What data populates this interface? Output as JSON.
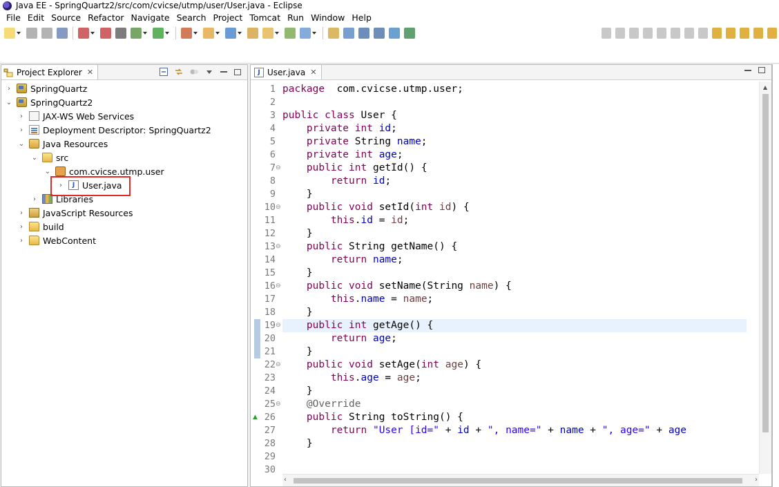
{
  "window": {
    "title": "Java EE - SpringQuartz2/src/com/cvicse/utmp/user/User.java - Eclipse"
  },
  "menu": [
    "File",
    "Edit",
    "Source",
    "Refactor",
    "Navigate",
    "Search",
    "Project",
    "Tomcat",
    "Run",
    "Window",
    "Help"
  ],
  "toolbar_icons": [
    "new-icon",
    "save-icon",
    "save-all-icon",
    "print-icon",
    "debug-icon",
    "run-icon",
    "external-tools-icon",
    "open-type-icon",
    "search-icon",
    "perspective-icon"
  ],
  "explorer": {
    "tab_label": "Project Explorer",
    "close_glyph": "✕",
    "tree": [
      {
        "label": "SpringQuartz",
        "twisty": "›",
        "icon": "project-icon"
      },
      {
        "label": "SpringQuartz2",
        "twisty": "⌄",
        "icon": "project-icon"
      },
      {
        "label": "JAX-WS Web Services",
        "twisty": "›",
        "icon": "web-services-icon"
      },
      {
        "label": "Deployment Descriptor: SpringQuartz2",
        "twisty": "›",
        "icon": "deployment-descriptor-icon"
      },
      {
        "label": "Java Resources",
        "twisty": "⌄",
        "icon": "java-resources-icon"
      },
      {
        "label": "src",
        "twisty": "⌄",
        "icon": "source-folder-icon"
      },
      {
        "label": "com.cvicse.utmp.user",
        "twisty": "⌄",
        "icon": "package-icon"
      },
      {
        "label": "User.java",
        "twisty": "›",
        "icon": "java-file-icon"
      },
      {
        "label": "Libraries",
        "twisty": "›",
        "icon": "libraries-icon"
      },
      {
        "label": "JavaScript Resources",
        "twisty": "›",
        "icon": "javascript-resources-icon"
      },
      {
        "label": "build",
        "twisty": "›",
        "icon": "folder-icon"
      },
      {
        "label": "WebContent",
        "twisty": "›",
        "icon": "folder-icon"
      }
    ]
  },
  "editor": {
    "tab_label": "User.java",
    "close_glyph": "✕",
    "current_line": 19,
    "lines": [
      {
        "n": "1",
        "t": [
          [
            "kw",
            "package"
          ],
          [
            "",
            "  com.cvicse.utmp.user;"
          ]
        ]
      },
      {
        "n": "2",
        "t": []
      },
      {
        "n": "3",
        "t": [
          [
            "kw",
            "public"
          ],
          [
            "",
            " "
          ],
          [
            "kw",
            "class"
          ],
          [
            "",
            " User {"
          ]
        ]
      },
      {
        "n": "4",
        "t": [
          [
            "",
            "    "
          ],
          [
            "kw",
            "private"
          ],
          [
            "",
            " "
          ],
          [
            "kw",
            "int"
          ],
          [
            "",
            " "
          ],
          [
            "fld",
            "id"
          ],
          [
            "",
            ";"
          ]
        ]
      },
      {
        "n": "5",
        "t": [
          [
            "",
            "    "
          ],
          [
            "kw",
            "private"
          ],
          [
            "",
            " String "
          ],
          [
            "fld",
            "name"
          ],
          [
            "",
            ";"
          ]
        ]
      },
      {
        "n": "6",
        "t": [
          [
            "",
            "    "
          ],
          [
            "kw",
            "private"
          ],
          [
            "",
            " "
          ],
          [
            "kw",
            "int"
          ],
          [
            "",
            " "
          ],
          [
            "fld",
            "age"
          ],
          [
            "",
            ";"
          ]
        ]
      },
      {
        "n": "7",
        "t": [
          [
            "",
            "    "
          ],
          [
            "kw",
            "public"
          ],
          [
            "",
            " "
          ],
          [
            "kw",
            "int"
          ],
          [
            "",
            " getId() {"
          ]
        ]
      },
      {
        "n": "8",
        "t": [
          [
            "",
            "        "
          ],
          [
            "kw",
            "return"
          ],
          [
            "",
            " "
          ],
          [
            "fld",
            "id"
          ],
          [
            "",
            ";"
          ]
        ]
      },
      {
        "n": "9",
        "t": [
          [
            "",
            "    }"
          ]
        ]
      },
      {
        "n": "10",
        "t": [
          [
            "",
            "    "
          ],
          [
            "kw",
            "public"
          ],
          [
            "",
            " "
          ],
          [
            "kw",
            "void"
          ],
          [
            "",
            " setId("
          ],
          [
            "kw",
            "int"
          ],
          [
            "",
            " "
          ],
          [
            "prm",
            "id"
          ],
          [
            "",
            ") {"
          ]
        ]
      },
      {
        "n": "11",
        "t": [
          [
            "",
            "        "
          ],
          [
            "kw",
            "this"
          ],
          [
            "",
            "."
          ],
          [
            "fld",
            "id"
          ],
          [
            "",
            " = "
          ],
          [
            "prm",
            "id"
          ],
          [
            "",
            ";"
          ]
        ]
      },
      {
        "n": "12",
        "t": [
          [
            "",
            "    }"
          ]
        ]
      },
      {
        "n": "13",
        "t": [
          [
            "",
            "    "
          ],
          [
            "kw",
            "public"
          ],
          [
            "",
            " String getName() {"
          ]
        ]
      },
      {
        "n": "14",
        "t": [
          [
            "",
            "        "
          ],
          [
            "kw",
            "return"
          ],
          [
            "",
            " "
          ],
          [
            "fld",
            "name"
          ],
          [
            "",
            ";"
          ]
        ]
      },
      {
        "n": "15",
        "t": [
          [
            "",
            "    }"
          ]
        ]
      },
      {
        "n": "16",
        "t": [
          [
            "",
            "    "
          ],
          [
            "kw",
            "public"
          ],
          [
            "",
            " "
          ],
          [
            "kw",
            "void"
          ],
          [
            "",
            " setName(String "
          ],
          [
            "prm",
            "name"
          ],
          [
            "",
            ") {"
          ]
        ]
      },
      {
        "n": "17",
        "t": [
          [
            "",
            "        "
          ],
          [
            "kw",
            "this"
          ],
          [
            "",
            "."
          ],
          [
            "fld",
            "name"
          ],
          [
            "",
            " = "
          ],
          [
            "prm",
            "name"
          ],
          [
            "",
            ";"
          ]
        ]
      },
      {
        "n": "18",
        "t": [
          [
            "",
            "    }"
          ]
        ]
      },
      {
        "n": "19",
        "t": [
          [
            "",
            "    "
          ],
          [
            "kw",
            "public"
          ],
          [
            "",
            " "
          ],
          [
            "kw",
            "int"
          ],
          [
            "",
            " getAge() {"
          ]
        ]
      },
      {
        "n": "20",
        "t": [
          [
            "",
            "        "
          ],
          [
            "kw",
            "return"
          ],
          [
            "",
            " "
          ],
          [
            "fld",
            "age"
          ],
          [
            "",
            ";"
          ]
        ]
      },
      {
        "n": "21",
        "t": [
          [
            "",
            "    }"
          ]
        ]
      },
      {
        "n": "22",
        "t": [
          [
            "",
            "    "
          ],
          [
            "kw",
            "public"
          ],
          [
            "",
            " "
          ],
          [
            "kw",
            "void"
          ],
          [
            "",
            " setAge("
          ],
          [
            "kw",
            "int"
          ],
          [
            "",
            " "
          ],
          [
            "prm",
            "age"
          ],
          [
            "",
            ") {"
          ]
        ]
      },
      {
        "n": "23",
        "t": [
          [
            "",
            "        "
          ],
          [
            "kw",
            "this"
          ],
          [
            "",
            "."
          ],
          [
            "fld",
            "age"
          ],
          [
            "",
            " = "
          ],
          [
            "prm",
            "age"
          ],
          [
            "",
            ";"
          ]
        ]
      },
      {
        "n": "24",
        "t": [
          [
            "",
            "    }"
          ]
        ]
      },
      {
        "n": "25",
        "t": [
          [
            "",
            "    "
          ],
          [
            "ann",
            "@Override"
          ]
        ]
      },
      {
        "n": "26",
        "t": [
          [
            "",
            "    "
          ],
          [
            "kw",
            "public"
          ],
          [
            "",
            " String toString() {"
          ]
        ]
      },
      {
        "n": "27",
        "t": [
          [
            "",
            "        "
          ],
          [
            "kw",
            "return"
          ],
          [
            "",
            " "
          ],
          [
            "str",
            "\"User [id=\""
          ],
          [
            "",
            " + "
          ],
          [
            "fld",
            "id"
          ],
          [
            "",
            " + "
          ],
          [
            "str",
            "\", name=\""
          ],
          [
            "",
            " + "
          ],
          [
            "fld",
            "name"
          ],
          [
            "",
            " + "
          ],
          [
            "str",
            "\", age=\""
          ],
          [
            "",
            " + "
          ],
          [
            "fld",
            "age"
          ]
        ]
      },
      {
        "n": "28",
        "t": [
          [
            "",
            "    }"
          ]
        ]
      },
      {
        "n": "29",
        "t": []
      },
      {
        "n": "30",
        "t": []
      }
    ],
    "fold_lines": [
      "7",
      "10",
      "13",
      "16",
      "19",
      "22",
      "25"
    ],
    "occurrence_lines": [
      "19",
      "20",
      "21"
    ],
    "override_line": "26"
  }
}
